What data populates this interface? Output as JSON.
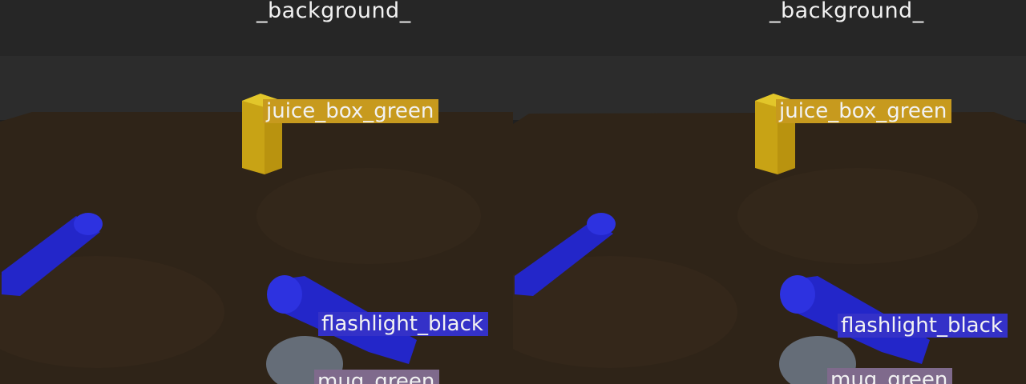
{
  "views": [
    {
      "id": "left",
      "labels": {
        "background": "_background_",
        "juice_box": "juice_box_green",
        "flashlight": "flashlight_black",
        "mug": "mug_green"
      }
    },
    {
      "id": "right",
      "labels": {
        "background": "_background_",
        "juice_box": "juice_box_green",
        "flashlight": "flashlight_black",
        "mug": "mug_green"
      }
    }
  ],
  "colors": {
    "wall": "#262626",
    "floor": "#2f2418",
    "juice_overlay": "#d4b21c",
    "flashlight_overlay": "#2a2ee0",
    "mug_overlay": "#8e9aa8",
    "juice_tag": "#c79a1e",
    "flashlight_tag": "#3431c8",
    "mug_tag": "#7f6a8c"
  }
}
